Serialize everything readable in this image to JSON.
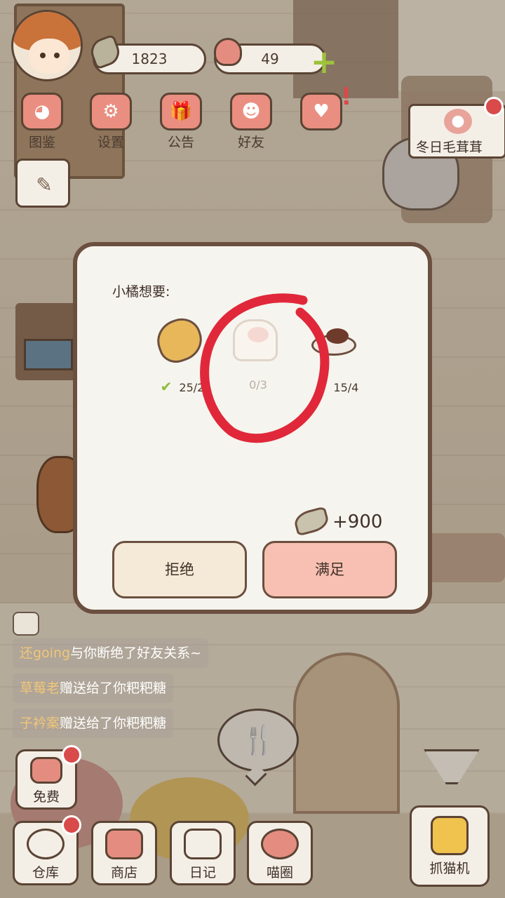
{
  "hud": {
    "fish_count": "1823",
    "heart_count": "49",
    "plus_label": "+",
    "menu": [
      {
        "label": "图鉴",
        "icon": "cat-face-icon"
      },
      {
        "label": "设置",
        "icon": "gear-icon"
      },
      {
        "label": "公告",
        "icon": "gift-icon"
      },
      {
        "label": "好友",
        "icon": "friends-icon"
      },
      {
        "label": "",
        "icon": "hearts-icon"
      }
    ],
    "event_badge": "冬日毛茸茸",
    "alert_mark": "!"
  },
  "modal": {
    "title": "小橘想要:",
    "requests": [
      {
        "item": "baked-potato",
        "count": "25/2",
        "fulfilled": true
      },
      {
        "item": "pig-bun",
        "count": "0/3",
        "fulfilled": false
      },
      {
        "item": "meat-plate",
        "count": "15/4",
        "fulfilled": true
      }
    ],
    "check_mark": "✔",
    "reward": "+900",
    "refuse_label": "拒绝",
    "accept_label": "满足"
  },
  "chat": [
    {
      "user": "还going",
      "text": "与你断绝了好友关系~"
    },
    {
      "user": "草莓老",
      "text": "赠送给了你粑粑糖"
    },
    {
      "user": "子衿案",
      "text": "赠送给了你粑粑糖"
    }
  ],
  "bottom": {
    "free": "免费",
    "warehouse": "仓库",
    "shop": "商店",
    "diary": "日记",
    "circle": "喵圈",
    "claw": "抓猫机"
  },
  "colors": {
    "accent_pink": "#f8c0b2",
    "border_brown": "#6b4f3f",
    "check_green": "#8cbc3a",
    "annotation_red": "#e0283a"
  }
}
